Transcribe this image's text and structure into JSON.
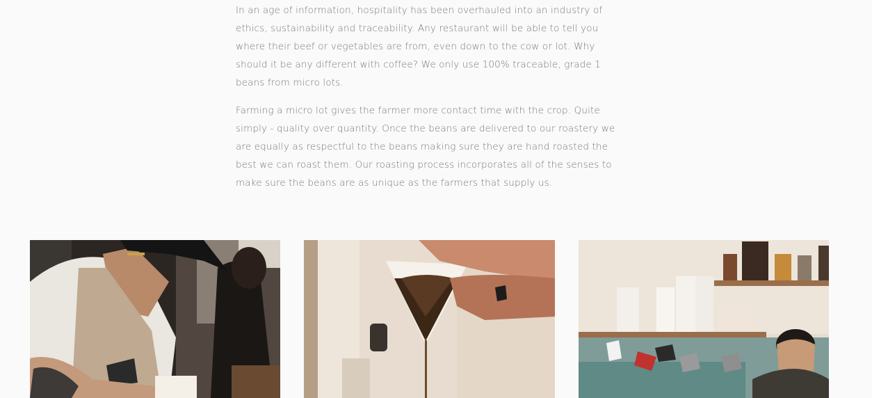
{
  "about": {
    "paragraph_1": "In an age of information, hospitality has been overhauled into an industry of ethics, sustainability and traceability. Any restaurant will be able to tell you where their beef or vegetables are from, even down to the cow or lot. Why should it be any different with coffee? We only use 100% traceable, grade 1 beans from micro lots.",
    "paragraph_2": "Farming a micro lot gives the farmer more contact time with the crop. Quite simply - quality over quantity. Once the beans are delivered to our roastery we are equally as respectful to the beans making sure they are hand roasted the best we can roast them. Our roasting process incorporates all of the senses to make sure the beans are as unique as the farmers that supply us."
  },
  "gallery": {
    "photos": [
      {
        "subject": "barista-writing"
      },
      {
        "subject": "pour-over-coffee-filter"
      },
      {
        "subject": "barista-at-shelf-counter"
      }
    ]
  }
}
